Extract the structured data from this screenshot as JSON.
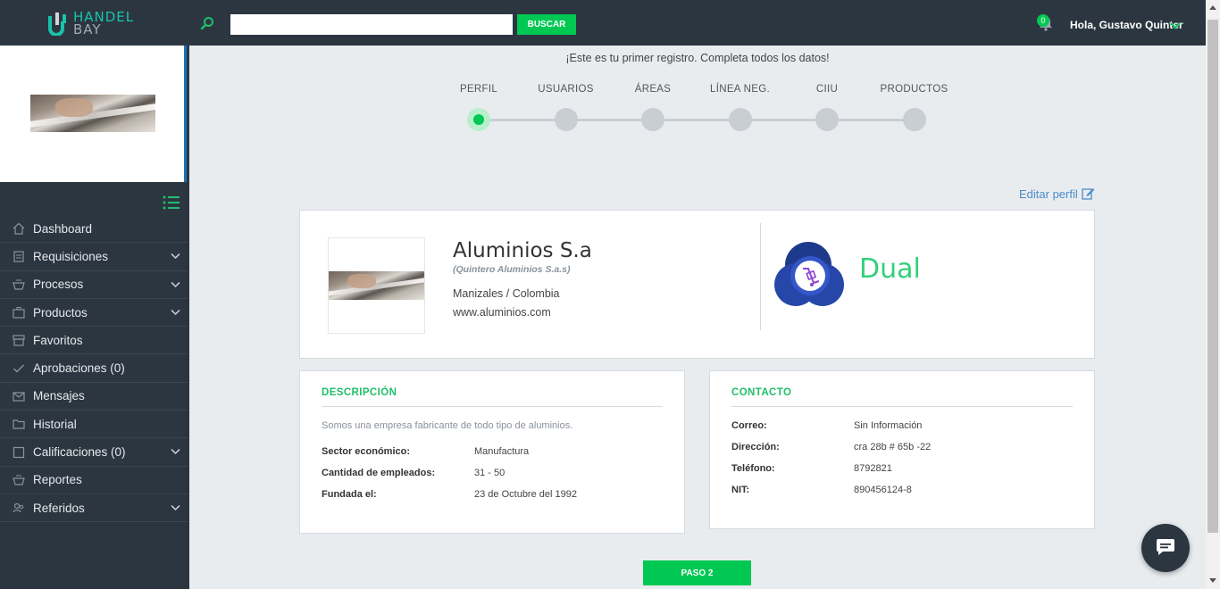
{
  "header": {
    "logo_line1": "HANDEL",
    "logo_line2": "BAY",
    "search_placeholder": "",
    "search_button": "BUSCAR",
    "notification_count": "0",
    "user_greeting": "Hola, Gustavo Quinter"
  },
  "sidebar": {
    "items": [
      {
        "label": "Dashboard",
        "icon": "home-icon",
        "expandable": false
      },
      {
        "label": "Requisiciones",
        "icon": "clipboard-icon",
        "expandable": true
      },
      {
        "label": "Procesos",
        "icon": "basket-icon",
        "expandable": true
      },
      {
        "label": "Productos",
        "icon": "briefcase-icon",
        "expandable": true
      },
      {
        "label": "Favoritos",
        "icon": "store-icon",
        "expandable": false
      },
      {
        "label": "Aprobaciones (0)",
        "icon": "check-icon",
        "expandable": false
      },
      {
        "label": "Mensajes",
        "icon": "envelope-icon",
        "expandable": false
      },
      {
        "label": "Historial",
        "icon": "folder-icon",
        "expandable": false
      },
      {
        "label": "Calificaciones (0)",
        "icon": "square-icon",
        "expandable": true
      },
      {
        "label": "Reportes",
        "icon": "basket-icon",
        "expandable": false
      },
      {
        "label": "Referidos",
        "icon": "users-icon",
        "expandable": true
      }
    ]
  },
  "main": {
    "first_message": "¡Este es tu primer registro. Completa todos los datos!",
    "steps": [
      "PERFIL",
      "USUARIOS",
      "ÁREAS",
      "LÍNEA NEG.",
      "CIIU",
      "PRODUCTOS"
    ],
    "active_step": 0,
    "edit_profile": "Editar perfil",
    "next_button": "PASO 2"
  },
  "profile": {
    "name": "Aluminios S.a",
    "legal_name": "(Quintero Aluminios S.a.s)",
    "location": "Manizales / Colombia",
    "website": "www.aluminios.com",
    "plan": "Dual"
  },
  "description": {
    "title": "DESCRIPCIÓN",
    "text": "Somos una empresa fabricante de todo tipo de aluminios.",
    "rows": [
      {
        "label": "Sector económico:",
        "value": "Manufactura"
      },
      {
        "label": "Cantidad de empleados:",
        "value": "31 - 50"
      },
      {
        "label": "Fundada el:",
        "value": "23 de Octubre del 1992"
      }
    ]
  },
  "contact": {
    "title": "CONTACTO",
    "rows": [
      {
        "label": "Correo:",
        "value": "Sin Información"
      },
      {
        "label": "Dirección:",
        "value": "cra 28b # 65b -22"
      },
      {
        "label": "Teléfono:",
        "value": "8792821"
      },
      {
        "label": "NIT:",
        "value": "890456124-8"
      }
    ]
  },
  "colors": {
    "brand_dark": "#2c3641",
    "accent_green": "#00c853",
    "link_blue": "#4a8cc8",
    "plan_green": "#33d17a"
  }
}
